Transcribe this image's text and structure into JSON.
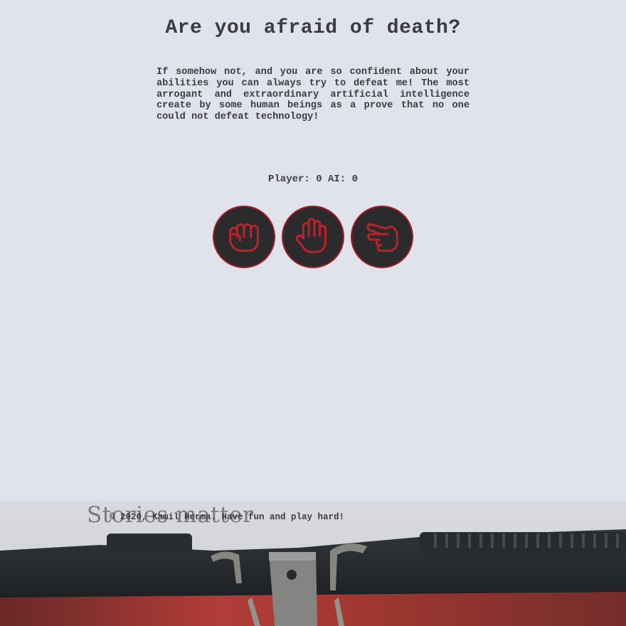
{
  "page": {
    "title": "Are you afraid of death?",
    "intro": "If somehow not, and you are so confident about your abilities you can always try to defeat me! The most arrogant and extraordinary artificial intelligence create by some human beings as a prove that no one could not defeat technology!"
  },
  "score": {
    "text": "Player: 0 AI: 0",
    "player": 0,
    "ai": 0
  },
  "choices": [
    {
      "name": "rock",
      "icon": "hand-rock-icon"
    },
    {
      "name": "paper",
      "icon": "hand-paper-icon"
    },
    {
      "name": "scissors",
      "icon": "hand-scissors-icon"
    }
  ],
  "colors": {
    "background": "#e1e3ec",
    "text": "#3b3c42",
    "button_fill": "#2b2a2c",
    "accent_red": "#a41d22"
  },
  "footer": {
    "stamp_text": "Stories matter",
    "copyright": "© 2020, Kamil Herma. Have fun and play hard!"
  }
}
